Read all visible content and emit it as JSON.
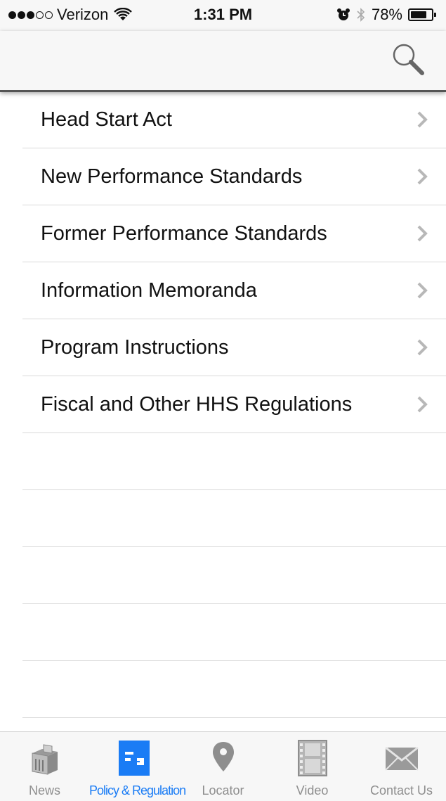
{
  "status_bar": {
    "carrier": "Verizon",
    "time": "1:31 PM",
    "battery_percent": "78%",
    "battery_level": 0.78,
    "signal_bars_filled": 3,
    "signal_bars_total": 5
  },
  "nav": {
    "search_icon": "search-icon"
  },
  "list": {
    "items": [
      {
        "label": "Head Start Act"
      },
      {
        "label": "New Performance Standards"
      },
      {
        "label": "Former Performance Standards"
      },
      {
        "label": "Information Memoranda"
      },
      {
        "label": "Program Instructions"
      },
      {
        "label": "Fiscal and Other HHS Regulations"
      }
    ],
    "chevron_icon": "chevron-right-icon"
  },
  "tab_bar": {
    "active_color": "#1a7cf5",
    "inactive_color": "#8e8e8e",
    "tabs": [
      {
        "label": "News",
        "icon": "news-icon"
      },
      {
        "label": "Policy & Regulation",
        "icon": "policy-icon",
        "active": true
      },
      {
        "label": "Locator",
        "icon": "location-pin-icon"
      },
      {
        "label": "Video",
        "icon": "film-icon"
      },
      {
        "label": "Contact Us",
        "icon": "envelope-icon"
      }
    ]
  }
}
